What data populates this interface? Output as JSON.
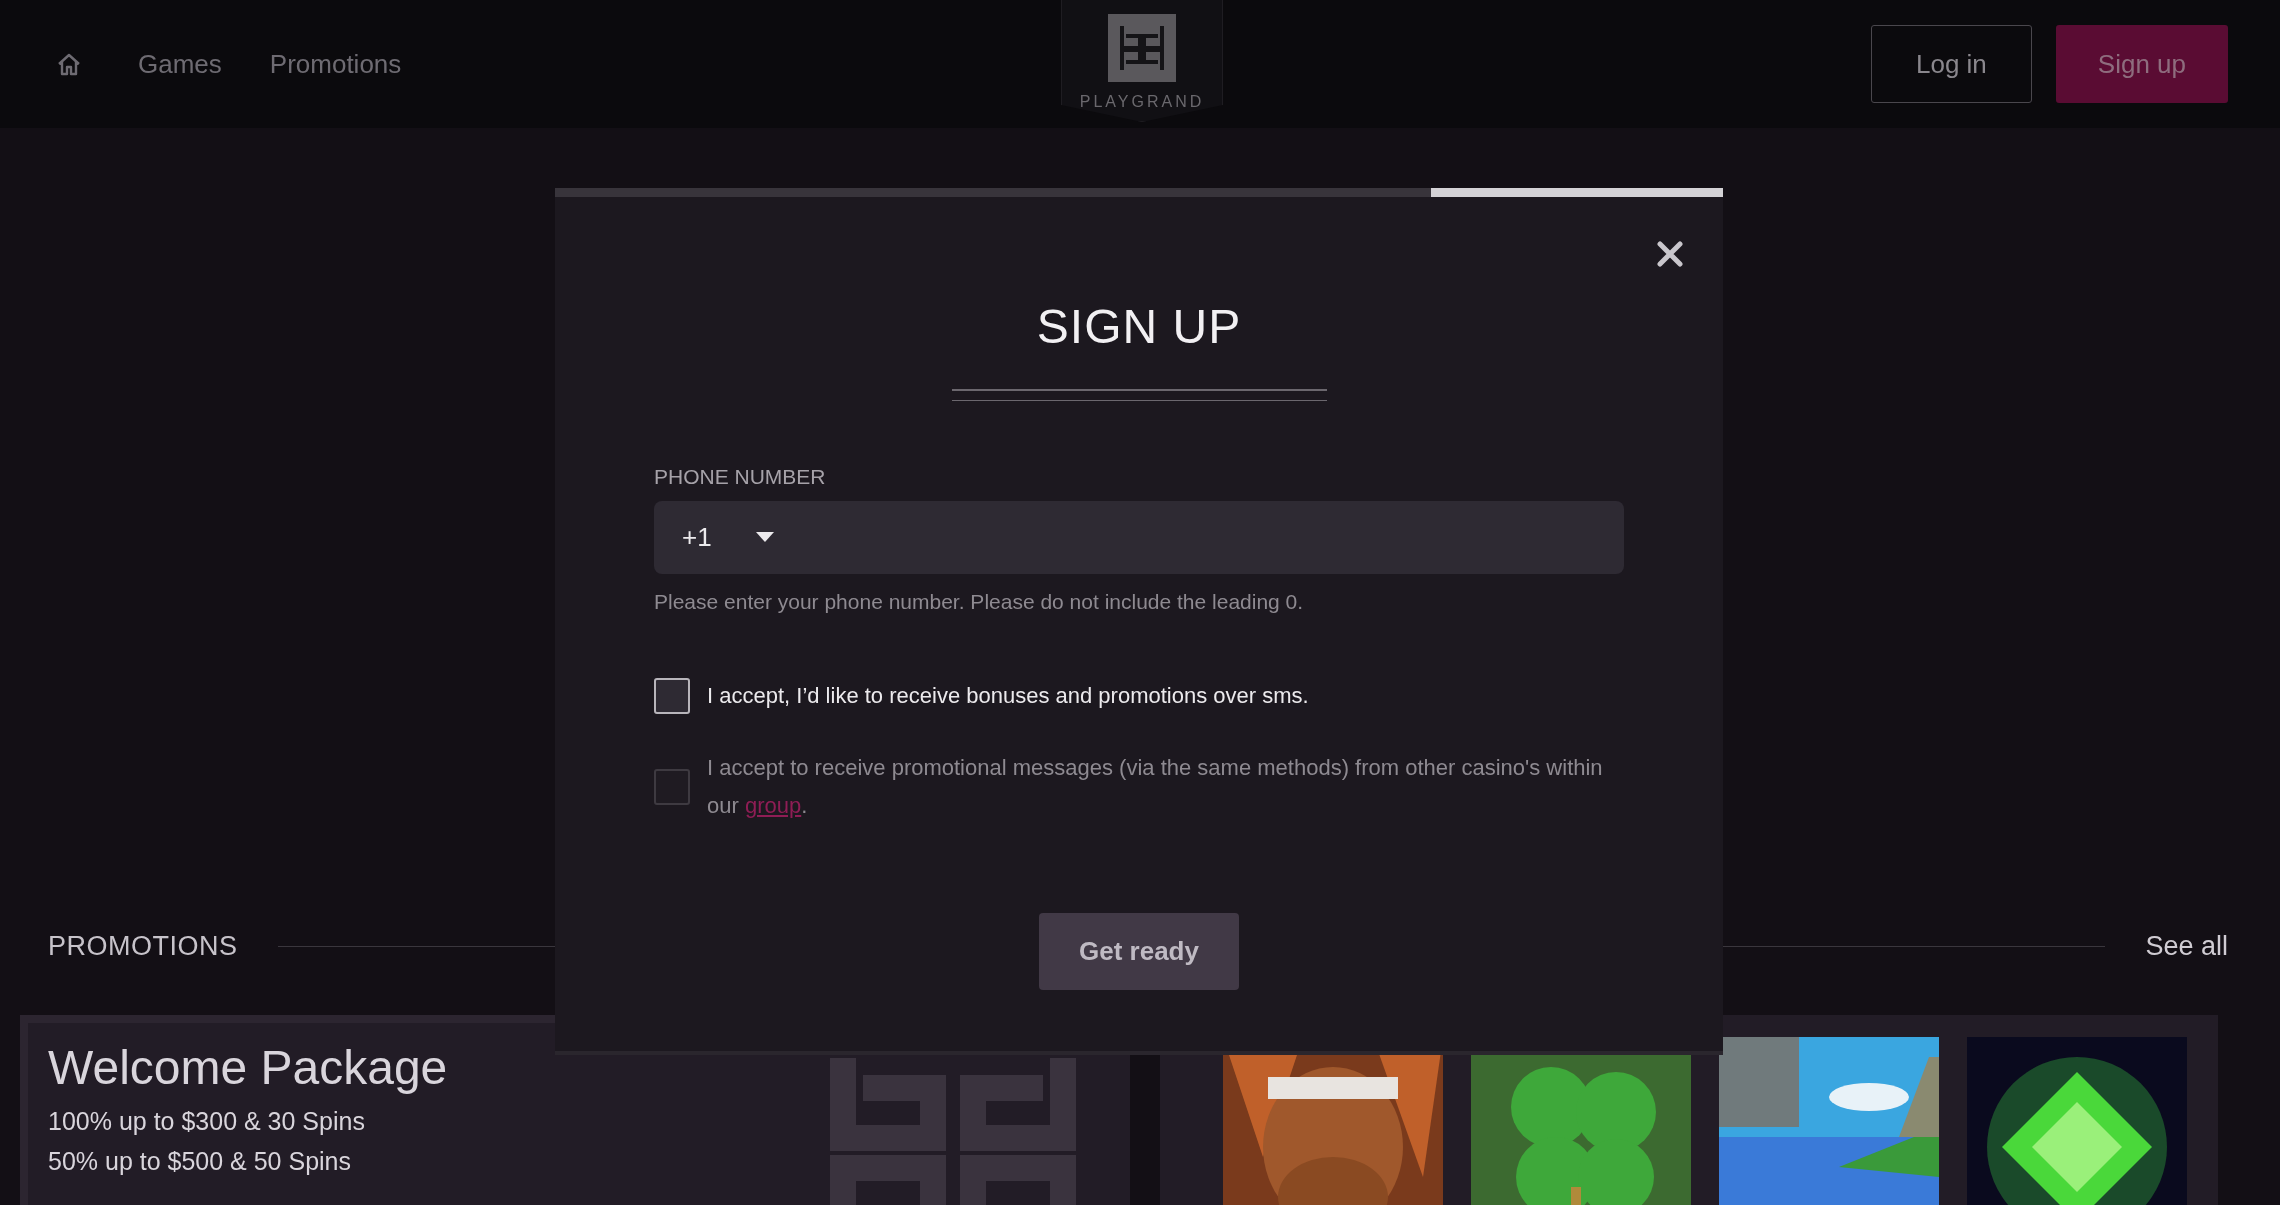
{
  "header": {
    "nav": [
      "Games",
      "Promotions"
    ],
    "logo_text": "PLAYGRAND",
    "buttons": [
      {
        "label": "Log in",
        "kind": "outline"
      },
      {
        "label": "Sign up",
        "kind": "primary"
      }
    ]
  },
  "modal": {
    "progress": {
      "level": 0.25
    },
    "title": "SIGN UP",
    "phone": {
      "label": "PHONE NUMBER",
      "country_code": "+1",
      "help": "Please enter your phone number. Please do not include the leading 0."
    },
    "consents": [
      {
        "text": "I accept, I’d like to receive bonuses and promotions over sms.",
        "checked": false,
        "disabled": false
      },
      {
        "text": "I accept to receive promotional messages (via the same methods) from other casino's within our ",
        "link": "group",
        "suffix": ".",
        "checked": false,
        "disabled": true
      }
    ],
    "submit": "Get ready"
  },
  "promotions": {
    "title": "PROMOTIONS",
    "see_all": "See all",
    "welcome": {
      "title": "Welcome Package",
      "lines": [
        "100% up to $300 & 30 Spins",
        "50% up to $500 & 50 Spins"
      ]
    }
  }
}
